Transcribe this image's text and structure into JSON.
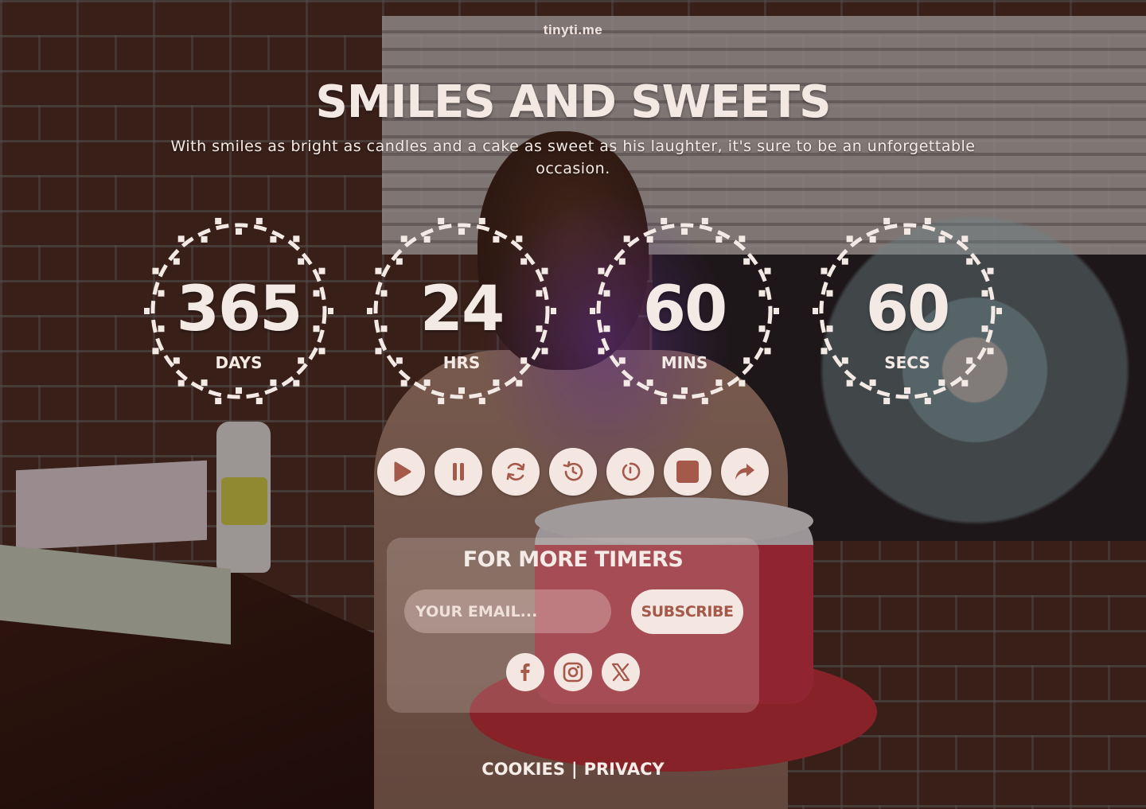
{
  "brand": "tinyti.me",
  "title": "Smiles and Sweets",
  "subtitle": "With smiles as bright as candles and a cake as sweet as his laughter, it's sure to be an unforgettable occasion.",
  "timers": [
    {
      "value": "365",
      "label": "Days"
    },
    {
      "value": "24",
      "label": "Hrs"
    },
    {
      "value": "60",
      "label": "mins"
    },
    {
      "value": "60",
      "label": "secs"
    }
  ],
  "controls": [
    "play-icon",
    "pause-icon",
    "refresh-icon",
    "history-icon",
    "restart-icon",
    "stop-icon",
    "share-icon"
  ],
  "colors": {
    "accent": "#f4e6e1",
    "accent_text": "#a4594a",
    "text": "#f4eae5"
  },
  "subscribe": {
    "title": "For More Timers",
    "email_placeholder": "YOUR EMAIL...",
    "button": "Subscribe"
  },
  "social": [
    "facebook-icon",
    "instagram-icon",
    "x-icon"
  ],
  "footer": {
    "cookies": "COOKIES",
    "separator": "|",
    "privacy": "PRIVACY"
  }
}
